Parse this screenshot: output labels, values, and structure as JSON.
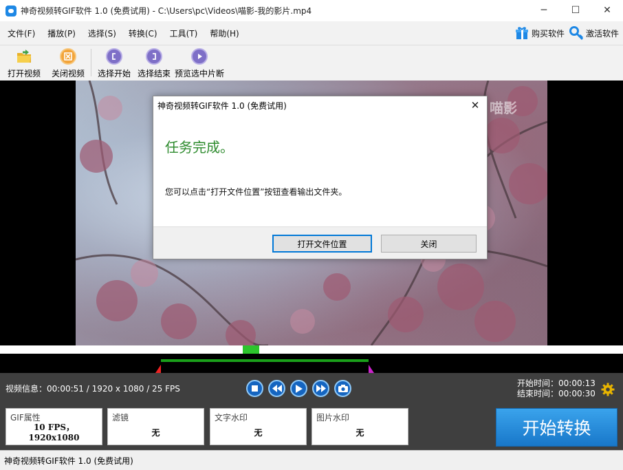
{
  "window": {
    "title": "神奇视频转GIF软件 1.0 (免费试用)  -  C:\\Users\\pc\\Videos\\喵影-我的影片.mp4",
    "minimize": "─",
    "maximize": "☐",
    "close": "✕"
  },
  "menu": {
    "items": [
      "文件(F)",
      "播放(P)",
      "选择(S)",
      "转换(C)",
      "工具(T)",
      "帮助(H)"
    ],
    "buy": "购买软件",
    "activate": "激活软件"
  },
  "toolbar": {
    "open_video": "打开视频",
    "close_video": "关闭视频",
    "select_start": "选择开始",
    "select_end": "选择结束",
    "preview_clip": "预览选中片断"
  },
  "video": {
    "watermark": "喵影"
  },
  "info": {
    "video_info": "视频信息：00:00:51 / 1920 x 1080 / 25 FPS",
    "start_time": "开始时间：00:00:13",
    "end_time": "结束时间：00:00:30"
  },
  "cards": {
    "gif_title": "GIF属性",
    "gif_value_1": "10 FPS，",
    "gif_value_2": "1920x1080",
    "filter_title": "滤镜",
    "filter_value": "无",
    "text_wm_title": "文字水印",
    "text_wm_value": "无",
    "image_wm_title": "图片水印",
    "image_wm_value": "无"
  },
  "convert_button": "开始转换",
  "status_bar": "神奇视频转GIF软件 1.0 (免费试用)",
  "dialog": {
    "title": "神奇视频转GIF软件 1.0 (免费试用)",
    "heading": "任务完成。",
    "message": "您可以点击“打开文件位置”按钮查看输出文件夹。",
    "open_location": "打开文件位置",
    "close": "关闭"
  },
  "colors": {
    "accent_blue": "#1877c9",
    "success_green": "#2e8b2e",
    "control_bg": "#3f3f3f"
  }
}
